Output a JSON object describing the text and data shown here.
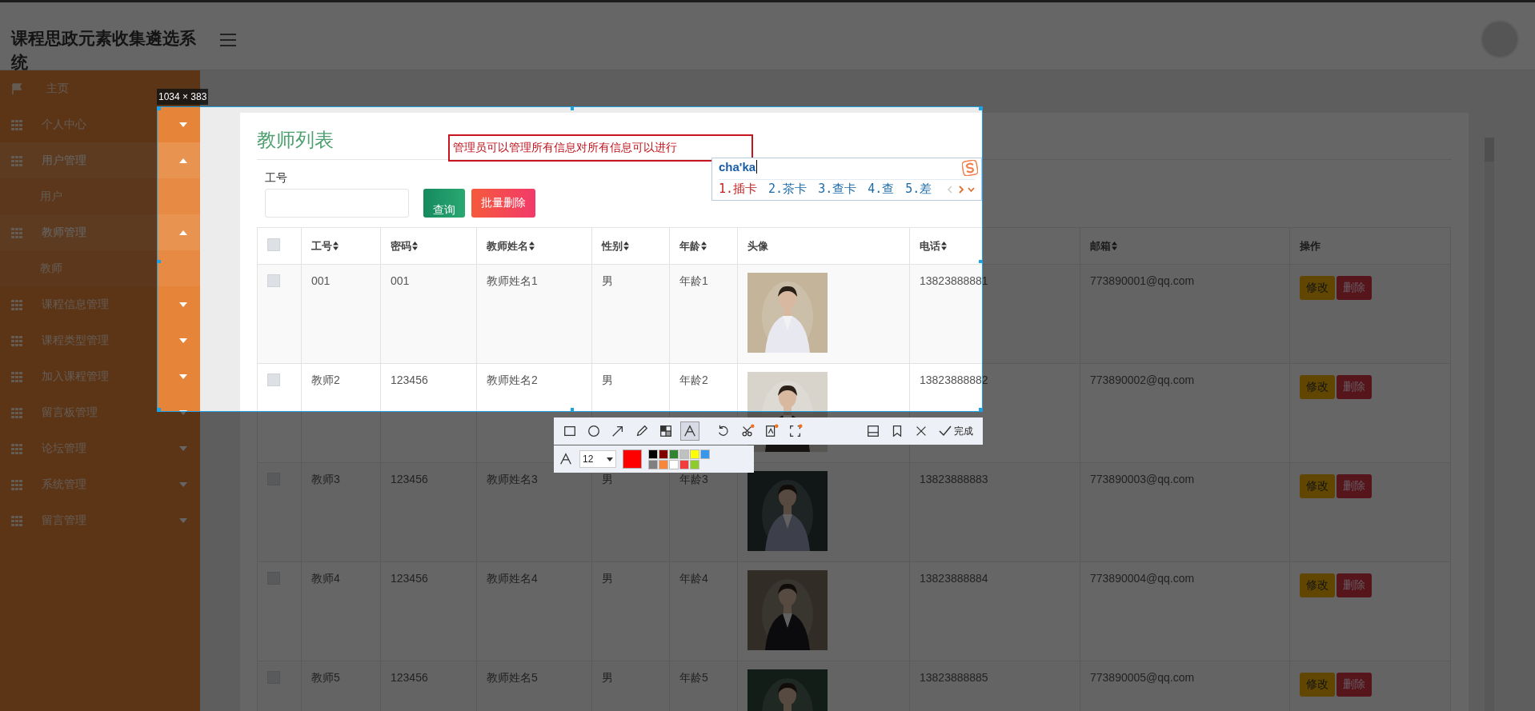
{
  "header": {
    "title": "课程思政元素收集遴选系统"
  },
  "sidebar": {
    "items": [
      {
        "label": "主页",
        "kind": "home"
      },
      {
        "label": "个人中心",
        "kind": "group",
        "expanded": false
      },
      {
        "label": "用户管理",
        "kind": "group",
        "expanded": true,
        "children": [
          {
            "label": "用户"
          }
        ]
      },
      {
        "label": "教师管理",
        "kind": "group",
        "expanded": true,
        "children": [
          {
            "label": "教师"
          }
        ]
      },
      {
        "label": "课程信息管理",
        "kind": "group",
        "expanded": false
      },
      {
        "label": "课程类型管理",
        "kind": "group",
        "expanded": false
      },
      {
        "label": "加入课程管理",
        "kind": "group",
        "expanded": false
      },
      {
        "label": "留言板管理",
        "kind": "group",
        "expanded": false
      },
      {
        "label": "论坛管理",
        "kind": "group",
        "expanded": false
      },
      {
        "label": "系统管理",
        "kind": "group",
        "expanded": false
      },
      {
        "label": "留言管理",
        "kind": "group",
        "expanded": false
      }
    ]
  },
  "panel": {
    "title": "教师列表",
    "search": {
      "label": "工号"
    },
    "buttons": [
      {
        "label": "查询",
        "kind": "search"
      },
      {
        "label": "批量删除",
        "kind": "delete"
      }
    ],
    "table": {
      "select_all_checked": false,
      "columns": [
        {
          "label": "工号",
          "sortable": true
        },
        {
          "label": "密码",
          "sortable": true
        },
        {
          "label": "教师姓名",
          "sortable": true
        },
        {
          "label": "性别",
          "sortable": true
        },
        {
          "label": "年龄",
          "sortable": true
        },
        {
          "label": "头像",
          "sortable": false
        },
        {
          "label": "电话",
          "sortable": true
        },
        {
          "label": "邮箱",
          "sortable": true
        },
        {
          "label": "操作",
          "sortable": false
        }
      ],
      "rows": [
        {
          "checked": false,
          "cells": [
            "001",
            "001",
            "教师姓名1",
            "男",
            "年龄1",
            {
              "kind": "picture"
            },
            "13823888881",
            "773890001@qq.com"
          ],
          "actions": [
            {
              "label": "修改",
              "kind": "edit"
            },
            {
              "label": "删除",
              "kind": "delete"
            }
          ]
        },
        {
          "checked": false,
          "cells": [
            "教师2",
            "123456",
            "教师姓名2",
            "男",
            "年龄2",
            {
              "kind": "picture"
            },
            "13823888882",
            "773890002@qq.com"
          ],
          "actions": [
            {
              "label": "修改",
              "kind": "edit"
            },
            {
              "label": "删除",
              "kind": "delete"
            }
          ]
        },
        {
          "checked": false,
          "cells": [
            "教师3",
            "123456",
            "教师姓名3",
            "男",
            "年龄3",
            {
              "kind": "picture"
            },
            "13823888883",
            "773890003@qq.com"
          ],
          "actions": [
            {
              "label": "修改",
              "kind": "edit"
            },
            {
              "label": "删除",
              "kind": "delete"
            }
          ]
        },
        {
          "checked": false,
          "cells": [
            "教师4",
            "123456",
            "教师姓名4",
            "男",
            "年龄4",
            {
              "kind": "picture"
            },
            "13823888884",
            "773890004@qq.com"
          ],
          "actions": [
            {
              "label": "修改",
              "kind": "edit"
            },
            {
              "label": "删除",
              "kind": "delete"
            }
          ]
        },
        {
          "checked": false,
          "cells": [
            "教师5",
            "123456",
            "教师姓名5",
            "男",
            "年龄5",
            {
              "kind": "picture"
            },
            "13823888885",
            "773890005@qq.com"
          ],
          "actions": [
            {
              "label": "修改",
              "kind": "edit"
            },
            {
              "label": "删除",
              "kind": "delete"
            }
          ]
        }
      ]
    }
  },
  "screenshot_tool": {
    "size_label": "1034 × 383",
    "annotation": {
      "text": "管理员可以管理所有信息对所有信息可以进行"
    },
    "ime": {
      "input": "cha'ka",
      "candidates": [
        {
          "text": "1.插卡",
          "selected": true
        },
        {
          "text": "2.茶卡",
          "selected": false
        },
        {
          "text": "3.查卡",
          "selected": false
        },
        {
          "text": "4.查",
          "selected": false
        },
        {
          "text": "5.差",
          "selected": false
        }
      ]
    },
    "tools": [
      {
        "kind": "rectangle",
        "selected": false
      },
      {
        "kind": "ellipse",
        "selected": false
      },
      {
        "kind": "arrow",
        "selected": false
      },
      {
        "kind": "pencil",
        "selected": false
      },
      {
        "kind": "mosaic",
        "selected": false
      },
      {
        "kind": "text",
        "selected": true
      },
      {
        "kind": "undo",
        "selected": false
      },
      {
        "kind": "cut",
        "selected": false
      },
      {
        "kind": "ocr",
        "selected": false
      },
      {
        "kind": "capture",
        "selected": false
      },
      {
        "kind": "save",
        "selected": false
      },
      {
        "kind": "pin",
        "selected": false
      },
      {
        "kind": "close",
        "selected": false
      }
    ],
    "done": "完成",
    "font_size": "12",
    "current": {
      "color": "#ff0000"
    },
    "palette": [
      {
        "color": "#000000"
      },
      {
        "color": "#808080"
      },
      {
        "color": "#800000"
      },
      {
        "color": "#f7883a"
      },
      {
        "color": "#308430"
      },
      {
        "color": "#ffffff"
      },
      {
        "color": "#c0c0c0"
      },
      {
        "color": "#f03c3c"
      },
      {
        "color": "#ffff00"
      },
      {
        "color": "#8fcb2b"
      },
      {
        "color": "#3897e8"
      }
    ]
  }
}
